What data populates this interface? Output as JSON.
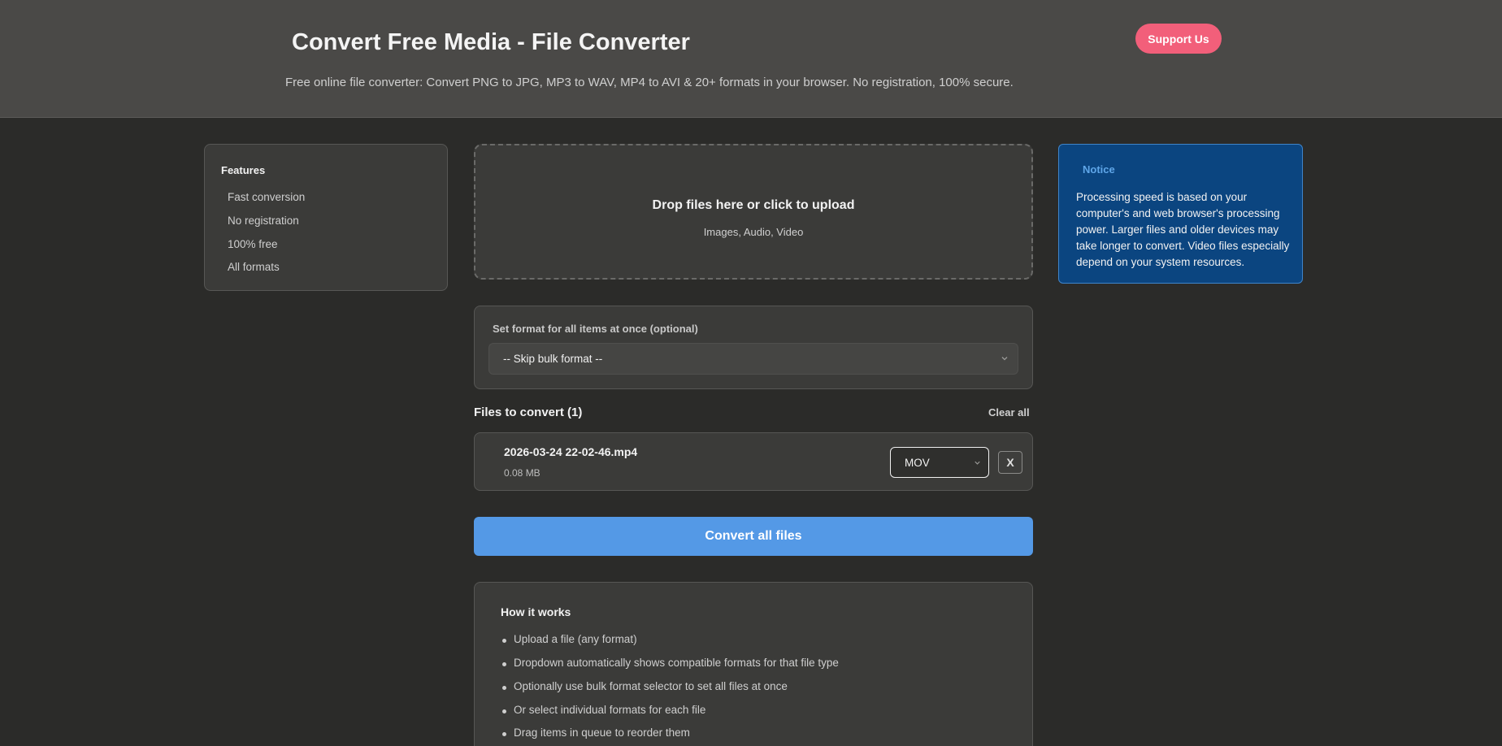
{
  "header": {
    "title": "Convert Free Media - File Converter",
    "subtitle": "Free online file converter: Convert PNG to JPG, MP3 to WAV, MP4 to AVI & 20+ formats in your browser. No registration, 100% secure.",
    "support_label": "Support Us"
  },
  "features": {
    "title": "Features",
    "items": [
      "Fast conversion",
      "No registration",
      "100% free",
      "All formats"
    ]
  },
  "dropzone": {
    "title": "Drop files here or click to upload",
    "subtitle": "Images, Audio, Video"
  },
  "notice": {
    "title": "Notice",
    "text": "Processing speed is based on your computer's and web browser's processing power. Larger files and older devices may take longer to convert. Video files especially depend on your system resources."
  },
  "bulk": {
    "label": "Set format for all items at once (optional)",
    "selected": "-- Skip bulk format --"
  },
  "queue": {
    "heading": "Files to convert (1)",
    "clear_label": "Clear all",
    "files": [
      {
        "name": "2026-03-24 22-02-46.mp4",
        "size": "0.08 MB",
        "format": "MOV",
        "remove_label": "X"
      }
    ]
  },
  "convert_label": "Convert all files",
  "how": {
    "title": "How it works",
    "items": [
      "Upload a file (any format)",
      "Dropdown automatically shows compatible formats for that file type",
      "Optionally use bulk format selector to set all files at once",
      "Or select individual formats for each file",
      "Drag items in queue to reorder them"
    ]
  },
  "colors": {
    "background": "#2b2b29",
    "header": "#4a4947",
    "accent_pink": "#f25f7a",
    "accent_blue": "#5499e6",
    "notice_bg": "#0b4580"
  }
}
